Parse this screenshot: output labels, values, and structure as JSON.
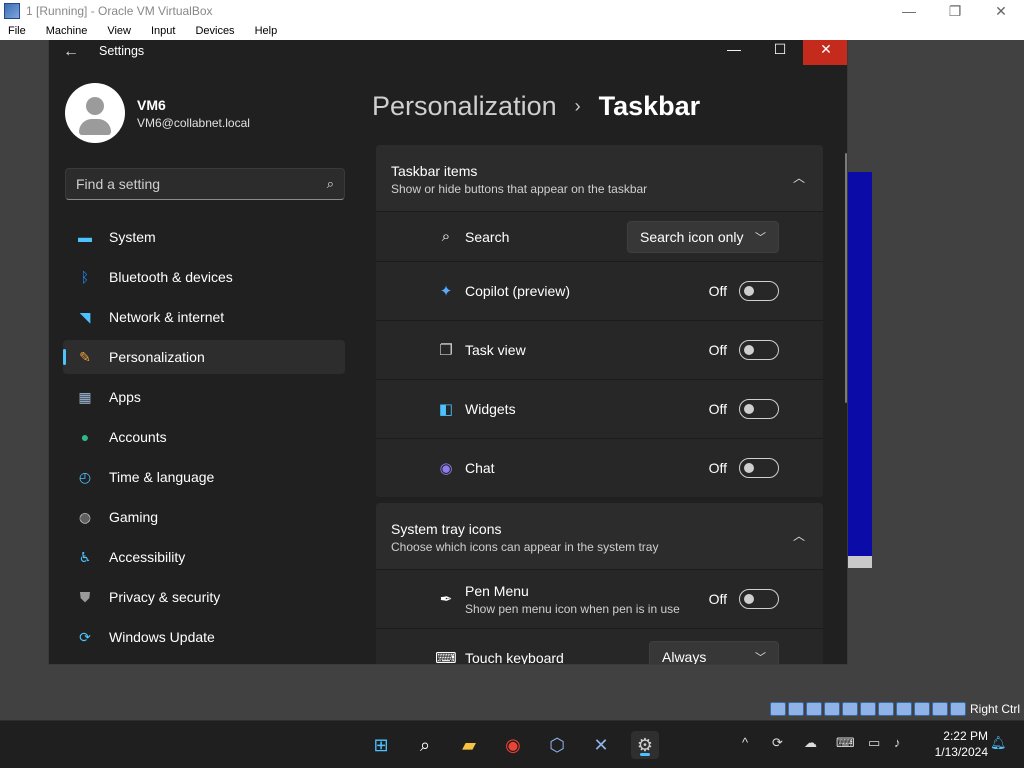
{
  "vbox": {
    "title": "1 [Running] - Oracle VM VirtualBox",
    "menu": [
      "File",
      "Machine",
      "View",
      "Input",
      "Devices",
      "Help"
    ],
    "status_right": "Right Ctrl"
  },
  "settings": {
    "app_title": "Settings",
    "user": {
      "name": "VM6",
      "email": "VM6@collabnet.local"
    },
    "search_placeholder": "Find a setting",
    "nav": [
      {
        "label": "System",
        "icon": "monitor-icon",
        "active": false
      },
      {
        "label": "Bluetooth & devices",
        "icon": "bluetooth-icon",
        "active": false
      },
      {
        "label": "Network & internet",
        "icon": "wifi-icon",
        "active": false
      },
      {
        "label": "Personalization",
        "icon": "brush-icon",
        "active": true
      },
      {
        "label": "Apps",
        "icon": "apps-icon",
        "active": false
      },
      {
        "label": "Accounts",
        "icon": "person-icon",
        "active": false
      },
      {
        "label": "Time & language",
        "icon": "globe-clock-icon",
        "active": false
      },
      {
        "label": "Gaming",
        "icon": "gamepad-icon",
        "active": false
      },
      {
        "label": "Accessibility",
        "icon": "accessibility-icon",
        "active": false
      },
      {
        "label": "Privacy & security",
        "icon": "shield-icon",
        "active": false
      },
      {
        "label": "Windows Update",
        "icon": "update-icon",
        "active": false
      }
    ],
    "breadcrumb": {
      "parent": "Personalization",
      "current": "Taskbar"
    },
    "taskbar_items": {
      "title": "Taskbar items",
      "subtitle": "Show or hide buttons that appear on the taskbar",
      "search": {
        "label": "Search",
        "value": "Search icon only"
      },
      "toggles": [
        {
          "label": "Copilot (preview)",
          "state": "Off",
          "on": false,
          "icon": "copilot-icon"
        },
        {
          "label": "Task view",
          "state": "Off",
          "on": false,
          "icon": "task-view-icon"
        },
        {
          "label": "Widgets",
          "state": "Off",
          "on": false,
          "icon": "widgets-icon"
        },
        {
          "label": "Chat",
          "state": "Off",
          "on": false,
          "icon": "chat-icon"
        }
      ]
    },
    "system_tray": {
      "title": "System tray icons",
      "subtitle": "Choose which icons can appear in the system tray",
      "pen_menu": {
        "label": "Pen Menu",
        "sub": "Show pen menu icon when pen is in use",
        "state": "Off",
        "on": false
      },
      "touch_keyboard": {
        "label": "Touch keyboard",
        "value": "Always"
      }
    }
  },
  "taskbar": {
    "time": "2:22 PM",
    "date": "1/13/2024"
  },
  "colors": {
    "accent": "#4cc2ff",
    "close": "#c42b1c",
    "bg": "#202020"
  }
}
